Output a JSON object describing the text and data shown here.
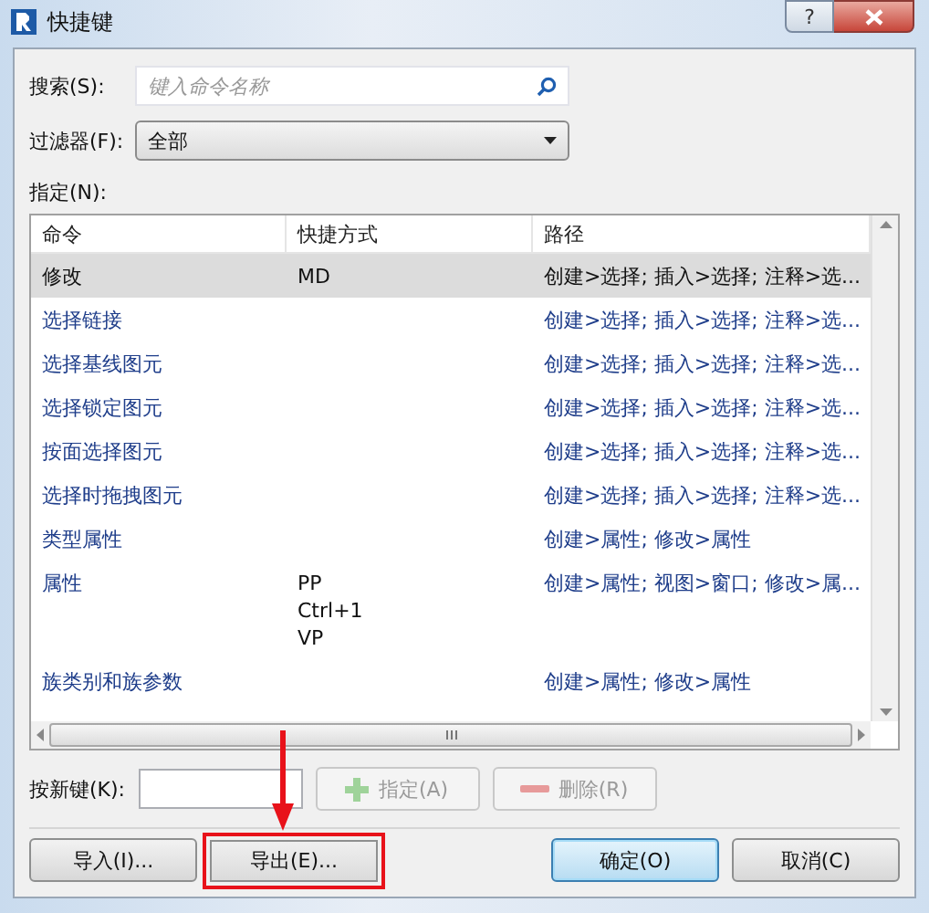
{
  "window": {
    "title": "快捷键",
    "help_label": "?"
  },
  "search": {
    "label": "搜索(S):",
    "placeholder": "键入命令名称"
  },
  "filter": {
    "label": "过滤器(F):",
    "value": "全部"
  },
  "assign_label": "指定(N):",
  "table": {
    "columns": [
      "命令",
      "快捷方式",
      "路径"
    ],
    "rows": [
      {
        "command": "修改",
        "shortcuts": [
          "MD"
        ],
        "path": "创建>选择; 插入>选择; 注释>选...",
        "selected": true
      },
      {
        "command": "选择链接",
        "shortcuts": [],
        "path": "创建>选择; 插入>选择; 注释>选...",
        "selected": false
      },
      {
        "command": "选择基线图元",
        "shortcuts": [],
        "path": "创建>选择; 插入>选择; 注释>选...",
        "selected": false
      },
      {
        "command": "选择锁定图元",
        "shortcuts": [],
        "path": "创建>选择; 插入>选择; 注释>选...",
        "selected": false
      },
      {
        "command": "按面选择图元",
        "shortcuts": [],
        "path": "创建>选择; 插入>选择; 注释>选...",
        "selected": false
      },
      {
        "command": "选择时拖拽图元",
        "shortcuts": [],
        "path": "创建>选择; 插入>选择; 注释>选...",
        "selected": false
      },
      {
        "command": "类型属性",
        "shortcuts": [],
        "path": "创建>属性; 修改>属性",
        "selected": false
      },
      {
        "command": "属性",
        "shortcuts": [
          "PP",
          "Ctrl+1",
          "VP"
        ],
        "path": "创建>属性; 视图>窗口; 修改>属...",
        "selected": false
      },
      {
        "command": "族类别和族参数",
        "shortcuts": [],
        "path": "创建>属性; 修改>属性",
        "selected": false
      }
    ]
  },
  "new_key": {
    "label": "按新键(K):",
    "assign_button": {
      "label": "指定(A)",
      "disabled": true
    },
    "remove_button": {
      "label": "删除(R)",
      "disabled": true
    }
  },
  "buttons": [
    {
      "label": "导入(I)...",
      "kind": "plain",
      "highlighted": false
    },
    {
      "label": "导出(E)...",
      "kind": "plain",
      "highlighted": true
    },
    {
      "label": "确定(O)",
      "kind": "default",
      "highlighted": false
    },
    {
      "label": "取消(C)",
      "kind": "plain",
      "highlighted": false
    }
  ]
}
